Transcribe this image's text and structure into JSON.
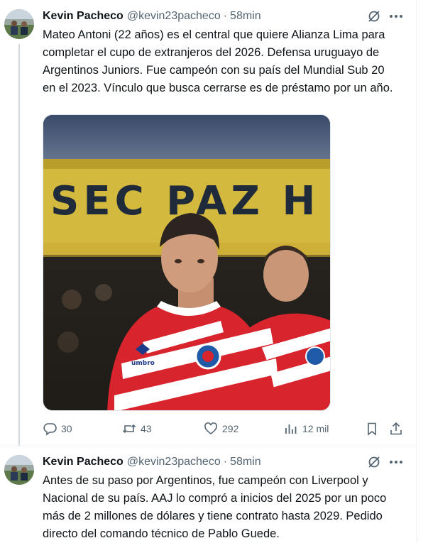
{
  "tweets": [
    {
      "author_name": "Kevin Pacheco",
      "handle": "@kevin23pacheco",
      "separator": "·",
      "time": "58min",
      "text": "Mateo Antoni (22 años) es el central que quiere Alianza Lima para completar el cupo de extranjeros del 2026. Defensa uruguayo de Argentinos Juniors. Fue campeón con su país del Mundial Sub 20 en el 2023. Vínculo que busca cerrarse es de préstamo por un año.",
      "media": {
        "banner_text": "SEC PAZ H",
        "kit_brand": "umbro"
      },
      "actions": {
        "replies": "30",
        "reposts": "43",
        "likes": "292",
        "views": "12 mil"
      }
    },
    {
      "author_name": "Kevin Pacheco",
      "handle": "@kevin23pacheco",
      "separator": "·",
      "time": "58min",
      "text": "Antes de su paso por Argentinos, fue campeón con Liverpool y Nacional de su país. AAJ lo compró a inicios del 2025 por un poco más de 2 millones de dólares y tiene contrato hasta 2029. Pedido directo del comando técnico de Pablo Guede."
    }
  ],
  "colors": {
    "text_primary": "#0f1419",
    "text_secondary": "#536471",
    "thread_line": "#cfd9de",
    "kit_red": "#d8242c"
  },
  "icons": [
    "grok-icon",
    "more-icon",
    "reply-icon",
    "repost-icon",
    "like-icon",
    "views-icon",
    "bookmark-icon",
    "share-icon"
  ]
}
